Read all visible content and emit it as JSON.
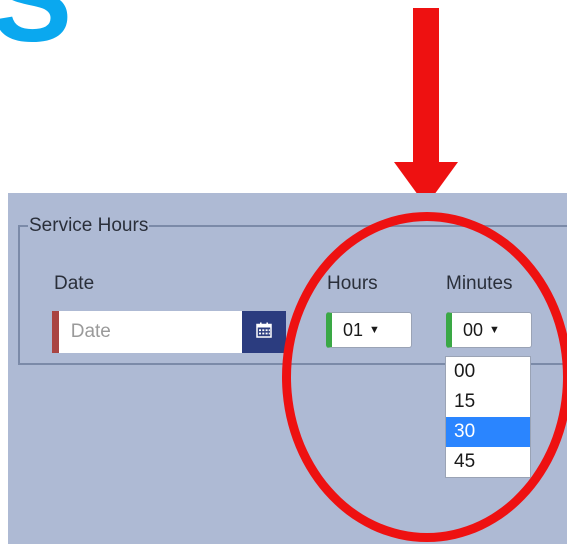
{
  "partial_heading": {
    "glyph": "S"
  },
  "service_hours": {
    "legend": "Service Hours",
    "date": {
      "label": "Date",
      "placeholder": "Date"
    },
    "hours": {
      "label": "Hours",
      "value": "01"
    },
    "minutes": {
      "label": "Minutes",
      "value": "00",
      "options": [
        "00",
        "15",
        "30",
        "45"
      ],
      "highlighted_option": "30"
    }
  },
  "icons": {
    "calendar": "calendar-icon",
    "select_caret": "▼"
  },
  "colors": {
    "panel_background": "#aebad4",
    "heading_blue": "#0aa8ef",
    "annotation_red": "#ee1111",
    "calendar_button": "#2b3c7f",
    "required_marker": "#a94442",
    "valid_marker": "#3aa845",
    "option_highlight": "#2a85ff"
  }
}
